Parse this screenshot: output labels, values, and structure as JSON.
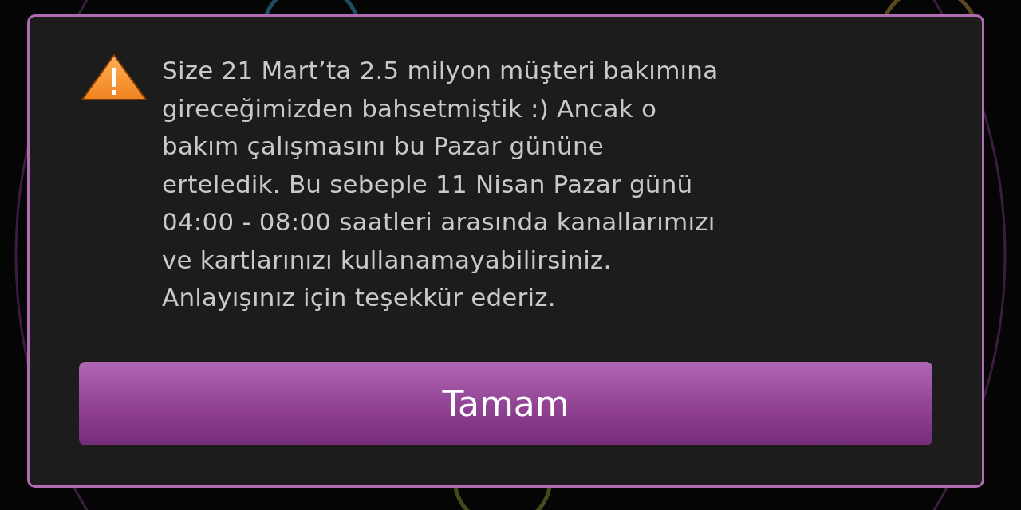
{
  "dialog": {
    "message": "Size 21 Mart’ta 2.5 milyon müşteri bakımına\ngireceğimizden bahsetmiştik :) Ancak o\nbakım çalışmasını bu Pazar gününe\nerteledik. Bu sebeple 11 Nisan Pazar günü\n04:00 - 08:00 saatleri arasında kanallarımızı\nve kartlarınızı kullanamayabilirsiniz.\nAnlayışınız için teşekkür ederiz.",
    "buttons": [
      {
        "label": "Tamam"
      }
    ]
  }
}
